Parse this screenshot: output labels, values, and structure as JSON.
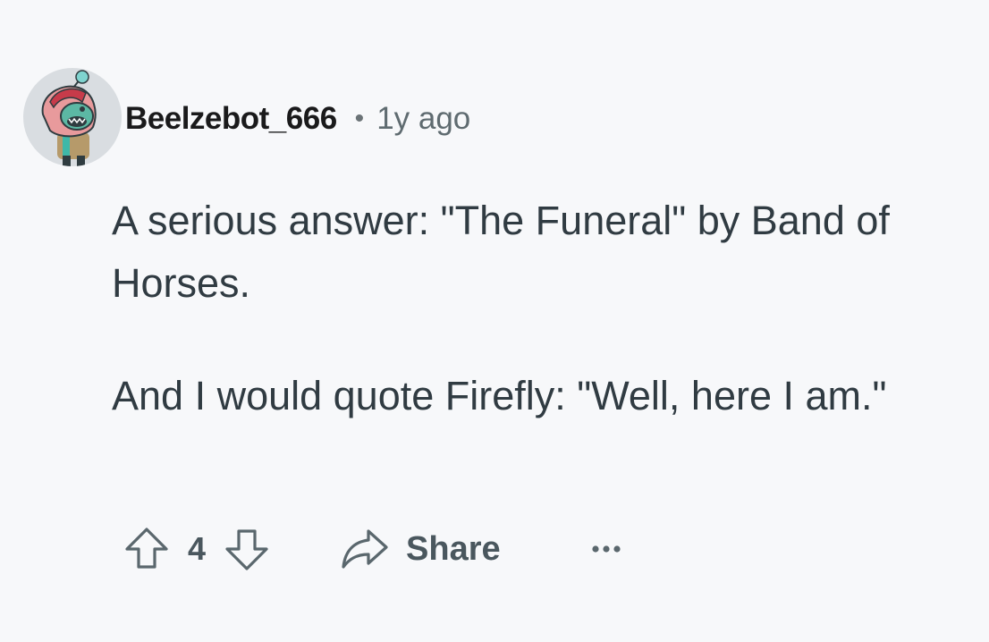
{
  "comment": {
    "author": "Beelzebot_666",
    "separator": "•",
    "timestamp": "1y ago",
    "paragraphs": [
      "A serious answer: \"The Funeral\" by Band of Horses.",
      "And I would quote Firefly: \"Well, here I am.\""
    ],
    "score": "4",
    "share_label": "Share",
    "more_label": "•••"
  },
  "icons": {
    "avatar": "snoo-avatar",
    "upvote": "upvote-arrow-icon",
    "downvote": "downvote-arrow-icon",
    "share": "share-arrow-icon",
    "more": "more-options-icon"
  },
  "colors": {
    "background": "#f7f8fa",
    "text": "#303b42",
    "muted": "#5f6b70",
    "icon": "#4a575e"
  }
}
